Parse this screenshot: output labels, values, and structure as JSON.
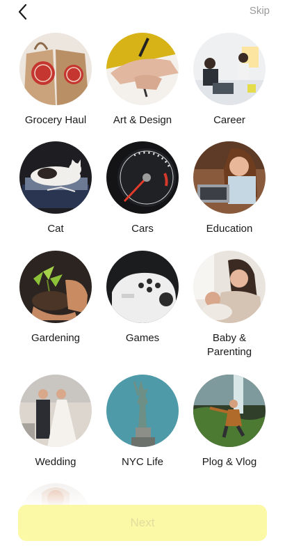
{
  "header": {
    "back_icon": "chevron-left-icon",
    "skip_label": "Skip"
  },
  "categories": [
    {
      "label": "Grocery Haul"
    },
    {
      "label": "Art & Design"
    },
    {
      "label": "Career"
    },
    {
      "label": "Cat"
    },
    {
      "label": "Cars"
    },
    {
      "label": "Education"
    },
    {
      "label": "Gardening"
    },
    {
      "label": "Games"
    },
    {
      "label": "Baby &\nParenting"
    },
    {
      "label": "Wedding"
    },
    {
      "label": "NYC Life"
    },
    {
      "label": "Plog & Vlog"
    }
  ],
  "footer": {
    "next_label": "Next"
  },
  "colors": {
    "next_bg": "#fbf8a6",
    "next_text": "#e2dd9c",
    "skip_text": "#9a9a9a"
  }
}
